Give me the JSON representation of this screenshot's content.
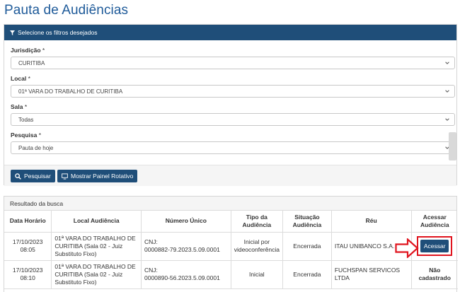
{
  "page": {
    "title": "Pauta de Audiências"
  },
  "filters": {
    "header": "Selecione os filtros desejados",
    "jurisdicao": {
      "label": "Jurisdição",
      "value": "CURITIBA"
    },
    "local": {
      "label": "Local",
      "value": "01ª VARA DO TRABALHO DE CURITIBA"
    },
    "sala": {
      "label": "Sala",
      "value": "Todas"
    },
    "pesquisa": {
      "label": "Pesquisa",
      "value": "Pauta de hoje"
    },
    "required_mark": "*",
    "buttons": {
      "search": "Pesquisar",
      "panel": "Mostrar Painel Rotativo"
    }
  },
  "results": {
    "header": "Resultado da busca",
    "columns": [
      "Data Horário",
      "Local Audiência",
      "Número Único",
      "Tipo da Audiência",
      "Situação Audiência",
      "Réu",
      "Acessar Audiência"
    ],
    "rows": [
      {
        "date": "17/10/2023",
        "time": "08:05",
        "local": "01ª VARA DO TRABALHO DE CURITIBA (Sala 02 - Juiz Substituto Fixo)",
        "cnj_label": "CNJ:",
        "cnj": "0000882-79.2023.5.09.0001",
        "tipo": "Inicial por videoconferência",
        "situacao": "Encerrada",
        "reu": "ITAU UNIBANCO S.A.",
        "acesso": "Acessar"
      },
      {
        "date": "17/10/2023",
        "time": "08:10",
        "local": "01ª VARA DO TRABALHO DE CURITIBA (Sala 02 - Juiz Substituto Fixo)",
        "cnj_label": "CNJ:",
        "cnj": "0000890-56.2023.5.09.0001",
        "tipo": "Inicial",
        "situacao": "Encerrada",
        "reu": "FUCHSPAN SERVICOS LTDA",
        "acesso": "Não cadastrado"
      }
    ]
  },
  "colors": {
    "primary": "#1f4e79",
    "title": "#1e5a99",
    "highlight": "#e0141e"
  },
  "icons": [
    "funnel-icon",
    "chevron-down-icon",
    "search-icon",
    "monitor-icon",
    "red-arrow-icon"
  ]
}
